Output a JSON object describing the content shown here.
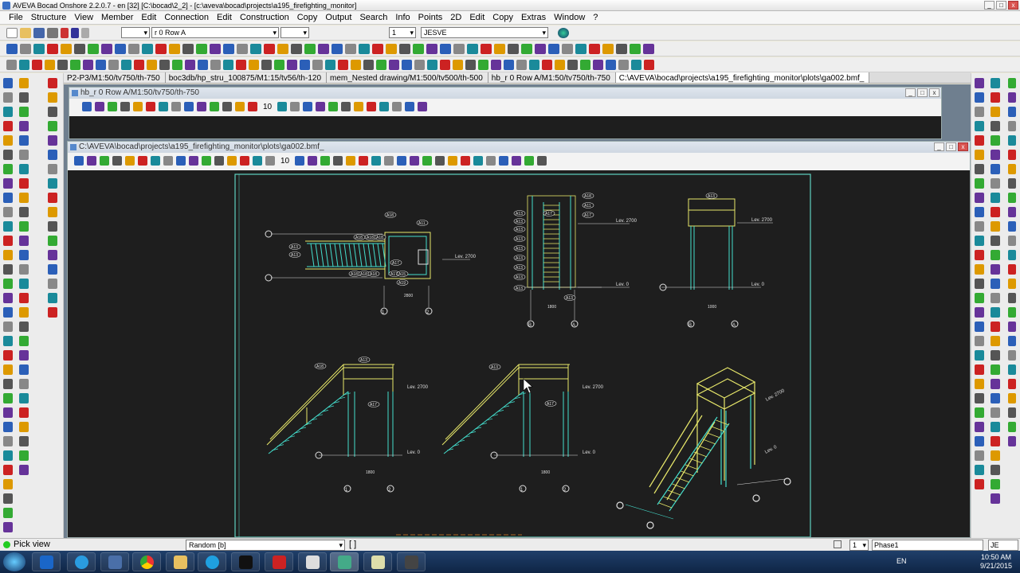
{
  "window": {
    "title": "AVEVA Bocad Onshore 2.2.0.7 - en [32]  [C:\\bocad\\2_2]  - [c:\\aveva\\bocad\\projects\\a195_firefighting_monitor]"
  },
  "menu": [
    "File",
    "Structure",
    "View",
    "Member",
    "Edit",
    "Connection",
    "Edit",
    "Construction",
    "Copy",
    "Output",
    "Search",
    "Info",
    "Points",
    "2D",
    "Edit",
    "Copy",
    "Extras",
    "Window",
    "?"
  ],
  "toolbar": {
    "row_combo": "r 0  Row A",
    "number_combo": "1",
    "user_combo": "JESVE"
  },
  "tabs": [
    "P2-P3/M1:50/tv750/th-750",
    "boc3db/hp_stru_100875/M1:15/tv56/th-120",
    "mem_Nested drawing/M1:500/tv500/th-500",
    "hb_r 0 Row A/M1:50/tv750/th-750",
    "C:\\AVEVA\\bocad\\projects\\a195_firefighting_monitor\\plots\\ga002.bmf_"
  ],
  "view_window": {
    "title": "hb_r 0 Row A/M1:50/tv750/th-750",
    "step": "10"
  },
  "plot_window": {
    "title": "C:\\AVEVA\\bocad\\projects\\a195_firefighting_monitor\\plots\\ga002.bmf_",
    "step": "10"
  },
  "drawing": {
    "callouts": {
      "a18": "A18",
      "a11": "A11",
      "a13": "A13",
      "a17": "A17",
      "a15": "A15",
      "a19": "A19",
      "a9": "A9"
    },
    "levels": {
      "lev_2700": "Lev. 2700",
      "lev_0": "Lev. 0"
    },
    "dims": {
      "d2800": "2800",
      "d1800": "1800",
      "d1000": "1000"
    },
    "grid_labels": {
      "one": "1",
      "two": "2",
      "a": "A",
      "b": "B"
    }
  },
  "status": {
    "pick_view": "Pick view",
    "mode_combo": "Random [b]",
    "brackets": "[ ]",
    "field_1": "1",
    "phase": "Phase1",
    "user": "JE"
  },
  "tray": {
    "lang": "EN",
    "time": "10:50 AM",
    "date": "9/21/2015"
  },
  "colors": {
    "canvas": "#1e1e1e",
    "cyan": "#44ddcc",
    "yellow": "#e8e86a",
    "white": "#e0e0e0",
    "frame": "#5fd3c2"
  }
}
